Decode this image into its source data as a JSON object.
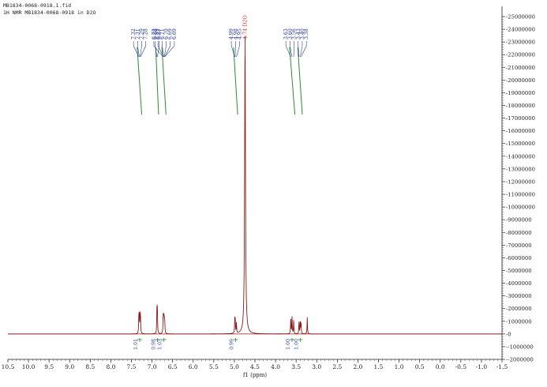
{
  "header": {
    "filename": "MB1834-0068-0918.1.fid",
    "experiment": "1H NMR MB1834-0068-0918 in D2O"
  },
  "colors": {
    "spectrum": "#8b1a1a",
    "peak_labels": "#1f2f8f",
    "solvent_label": "#d23a3a",
    "integral_curve": "#2e8b2e",
    "integral_labels": "#2a3a9a",
    "axis": "#222222"
  },
  "chart_data": {
    "type": "line",
    "title": "",
    "xlabel": "f1 (ppm)",
    "ylabel": "",
    "xlim": [
      10.5,
      -1.5
    ],
    "x_reversed": true,
    "ylim": [
      -2000000,
      25000000
    ],
    "grid": false,
    "x_ticks": [
      "10.5",
      "10.0",
      "9.5",
      "9.0",
      "8.5",
      "8.0",
      "7.5",
      "7.0",
      "6.5",
      "6.0",
      "5.5",
      "5.0",
      "4.5",
      "4.0",
      "3.5",
      "3.0",
      "2.5",
      "2.0",
      "1.5",
      "1.0",
      "0.5",
      "0.0",
      "-0.5",
      "-1.0",
      "-1.5"
    ],
    "y_ticks": [
      "25000000",
      "24000000",
      "23000000",
      "22000000",
      "21000000",
      "20000000",
      "19000000",
      "18000000",
      "17000000",
      "16000000",
      "15000000",
      "14000000",
      "13000000",
      "12000000",
      "11000000",
      "10000000",
      "9000000",
      "8000000",
      "7000000",
      "6000000",
      "5000000",
      "4000000",
      "3000000",
      "2000000",
      "1000000",
      "0",
      "-1000000",
      "-2000000"
    ],
    "peaks": [
      {
        "ppm": 7.32,
        "height": 1200000
      },
      {
        "ppm": 7.31,
        "height": 1350000
      },
      {
        "ppm": 7.29,
        "height": 1300000
      },
      {
        "ppm": 7.28,
        "height": 1100000
      },
      {
        "ppm": 6.88,
        "height": 1900000
      },
      {
        "ppm": 6.87,
        "height": 1700000
      },
      {
        "ppm": 6.73,
        "height": 1100000
      },
      {
        "ppm": 6.72,
        "height": 1050000
      },
      {
        "ppm": 6.71,
        "height": 950000
      },
      {
        "ppm": 6.7,
        "height": 800000
      },
      {
        "ppm": 6.69,
        "height": 700000
      },
      {
        "ppm": 4.99,
        "height": 1000000
      },
      {
        "ppm": 4.98,
        "height": 1000000
      },
      {
        "ppm": 4.95,
        "height": 800000
      },
      {
        "ppm": 4.74,
        "height": 23500000
      },
      {
        "ppm": 3.63,
        "height": 1250000
      },
      {
        "ppm": 3.6,
        "height": 1350000
      },
      {
        "ppm": 3.56,
        "height": 1050000
      },
      {
        "ppm": 3.43,
        "height": 950000
      },
      {
        "ppm": 3.4,
        "height": 1000000
      },
      {
        "ppm": 3.38,
        "height": 850000
      },
      {
        "ppm": 3.23,
        "height": 1300000
      }
    ],
    "peak_label_groups": [
      {
        "labels": [
          "7.32",
          "7.31",
          "7.29",
          "7.28"
        ],
        "ppms": [
          7.32,
          7.31,
          7.29,
          7.28
        ]
      },
      {
        "labels": [
          "6.88",
          "6.87"
        ],
        "ppms": [
          6.88,
          6.87
        ]
      },
      {
        "labels": [
          "6.73",
          "6.72",
          "6.71",
          "6.70",
          "6.69",
          "6.69"
        ],
        "ppms": [
          6.73,
          6.72,
          6.71,
          6.7,
          6.69,
          6.69
        ]
      },
      {
        "labels": [
          "4.99",
          "4.98",
          "4.95"
        ],
        "ppms": [
          4.99,
          4.98,
          4.95
        ]
      },
      {
        "labels": [
          "3.63",
          "3.60",
          "3.56",
          "3.43",
          "3.40",
          "3.38"
        ],
        "ppms": [
          3.63,
          3.6,
          3.56,
          3.43,
          3.4,
          3.38
        ]
      }
    ],
    "solvent_label": {
      "text": "4.74 D2O",
      "ppm": 4.74
    },
    "integrals": [
      {
        "ppm": 7.3,
        "value": "1.01"
      },
      {
        "ppm": 6.87,
        "value": "0.98"
      },
      {
        "ppm": 6.71,
        "value": "1.03"
      },
      {
        "ppm": 4.97,
        "value": "0.99"
      },
      {
        "ppm": 3.6,
        "value": "1.00"
      },
      {
        "ppm": 3.4,
        "value": "1.00"
      }
    ],
    "integral_curves": [
      {
        "from": 7.36,
        "to": 7.25
      },
      {
        "from": 6.91,
        "to": 6.84
      },
      {
        "from": 6.76,
        "to": 6.66
      },
      {
        "from": 5.02,
        "to": 4.92
      },
      {
        "from": 3.66,
        "to": 3.53
      },
      {
        "from": 3.46,
        "to": 3.35
      }
    ]
  }
}
